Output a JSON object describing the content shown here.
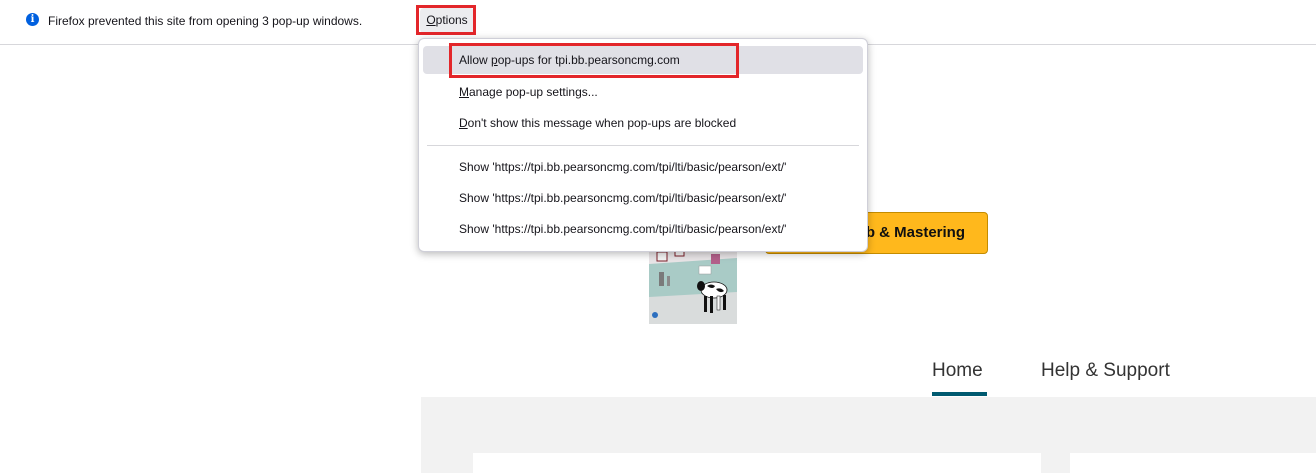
{
  "notification": {
    "message": "Firefox prevented this site from opening 3 pop-up windows.",
    "options_prefix": "",
    "options_key": "O",
    "options_rest": "ptions"
  },
  "menu": {
    "allow": {
      "pre": "Allow ",
      "key": "p",
      "post": "op-ups for tpi.bb.pearsoncmg.com"
    },
    "manage": {
      "pre": "",
      "key": "M",
      "post": "anage pop-up settings..."
    },
    "dont_show": {
      "pre": "",
      "key": "D",
      "post": "on't show this message when pop-ups are blocked"
    },
    "show_items": [
      "Show 'https://tpi.bb.pearsoncmg.com/tpi/lti/basic/pearson/ext/'",
      "Show 'https://tpi.bb.pearsoncmg.com/tpi/lti/basic/pearson/ext/'",
      "Show 'https://tpi.bb.pearsoncmg.com/tpi/lti/basic/pearson/ext/'"
    ]
  },
  "page": {
    "cta_label": "b & Mastering",
    "nav_home": "Home",
    "nav_help": "Help & Support"
  },
  "colors": {
    "highlight_box": "#e3262a",
    "cta_background": "#ffb81c",
    "nav_active_underline": "#005a70"
  }
}
